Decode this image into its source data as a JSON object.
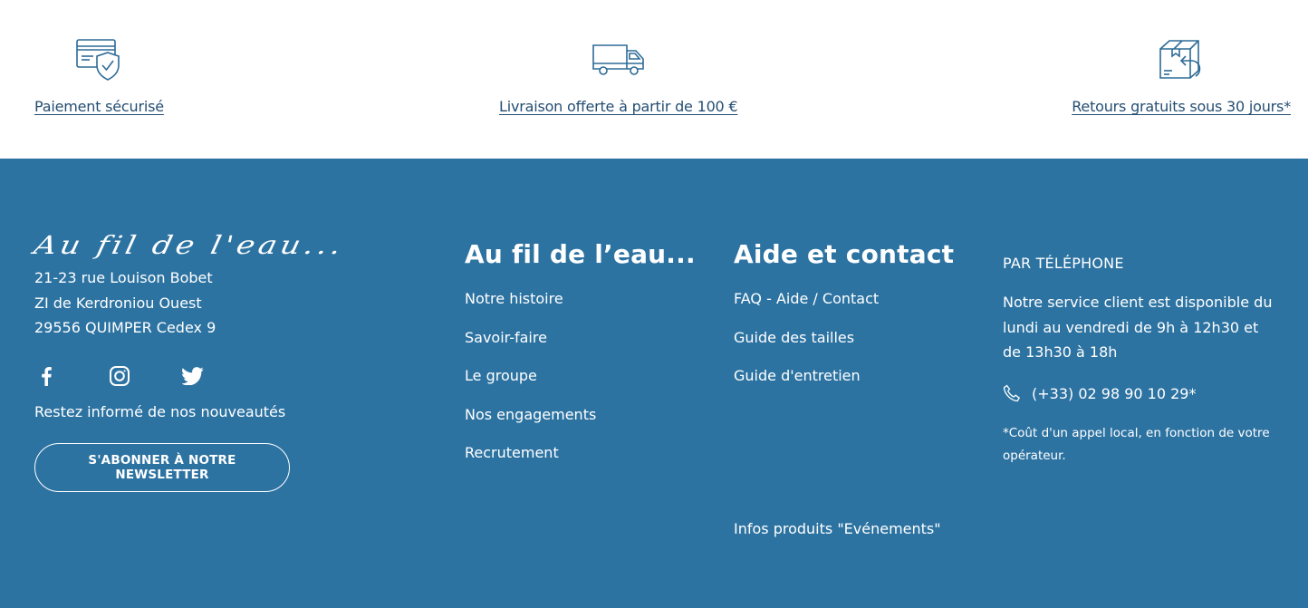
{
  "reassurance": {
    "items": [
      {
        "label": "Paiement sécurisé",
        "icon": "secure-payment-card-icon"
      },
      {
        "label": "Livraison offerte à partir de 100 €",
        "icon": "delivery-truck-icon"
      },
      {
        "label": "Retours gratuits sous 30 jours*",
        "icon": "return-box-icon"
      }
    ]
  },
  "footer": {
    "background": "#2d73a2",
    "brand": {
      "logo_text": "Au fil de l'eau...",
      "address": [
        "21-23 rue Louison Bobet",
        "ZI de Kerdroniou Ouest",
        "29556 QUIMPER Cedex 9"
      ],
      "social": [
        "facebook-icon",
        "instagram-icon",
        "twitter-icon"
      ],
      "newsletter_text": "Restez informé de nos nouveautés",
      "newsletter_button": "S'ABONNER À NOTRE NEWSLETTER"
    },
    "about": {
      "title": "Au fil de l’eau...",
      "links": [
        "Notre histoire",
        "Savoir-faire",
        "Le groupe",
        "Nos engagements",
        "Recrutement"
      ]
    },
    "help": {
      "title": "Aide et contact",
      "links": [
        "FAQ - Aide / Contact",
        "Guide des tailles",
        "Guide d'entretien"
      ],
      "extra_link": "Infos produits \"Evénements\""
    },
    "phone": {
      "heading": "PAR TÉLÉPHONE",
      "description": "Notre service client est disponible du lundi au vendredi de 9h à 12h30 et de 13h30 à 18h",
      "number": "(+33) 02 98 90 10 29*",
      "note": "*Coût d'un appel local, en fonction de votre opérateur."
    }
  }
}
